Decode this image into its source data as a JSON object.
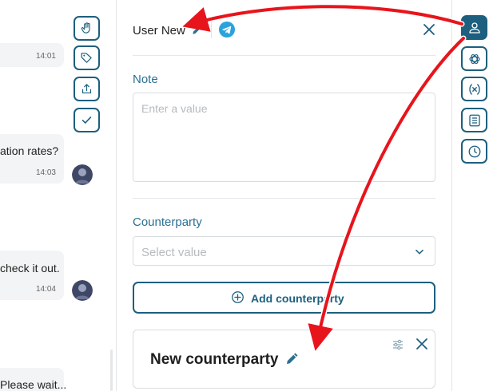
{
  "chat": {
    "messages": [
      {
        "text": "",
        "time": "14:01"
      },
      {
        "text": "ation rates?",
        "time": "14:03"
      },
      {
        "text": "check it out.",
        "time": "14:04"
      },
      {
        "text": "Please wait...",
        "time": ""
      }
    ],
    "actions": [
      "hand-icon",
      "tag-icon",
      "share-icon",
      "check-icon"
    ]
  },
  "header": {
    "username": "User New",
    "channel_icon": "telegram-icon"
  },
  "note": {
    "label": "Note",
    "placeholder": "Enter a value"
  },
  "counterparty": {
    "label": "Counterparty",
    "select_placeholder": "Select value",
    "add_button": "Add counterparty"
  },
  "card": {
    "title": "New counterparty"
  },
  "rail": {
    "buttons": [
      "user-icon",
      "openai-icon",
      "variable-icon",
      "document-icon",
      "clock-icon"
    ],
    "active": "user-icon"
  },
  "colors": {
    "accent": "#1d5f7e",
    "label": "#2b6f93",
    "annotation": "#e8141c",
    "telegram": "#2aa3dc"
  }
}
